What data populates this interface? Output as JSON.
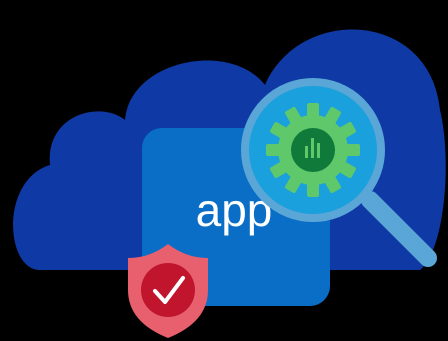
{
  "app_tile": {
    "label": "app"
  },
  "icons": {
    "cloud": "cloud-icon",
    "magnifier": "magnifying-glass-icon",
    "gear": "gear-icon",
    "chart": "bar-chart-icon",
    "shield": "shield-check-icon"
  },
  "colors": {
    "background": "#000000",
    "cloud": "#0f3aa6",
    "app_tile": "#0a6ec7",
    "lens_ring": "#5aa6d6",
    "lens_glass": "#1aa0dc",
    "gear": "#5ec86a",
    "gear_center": "#0f7a3a",
    "handle": "#5aa6d6",
    "shield": "#e8606d",
    "shield_inner": "#c0152d",
    "check": "#ffffff"
  }
}
